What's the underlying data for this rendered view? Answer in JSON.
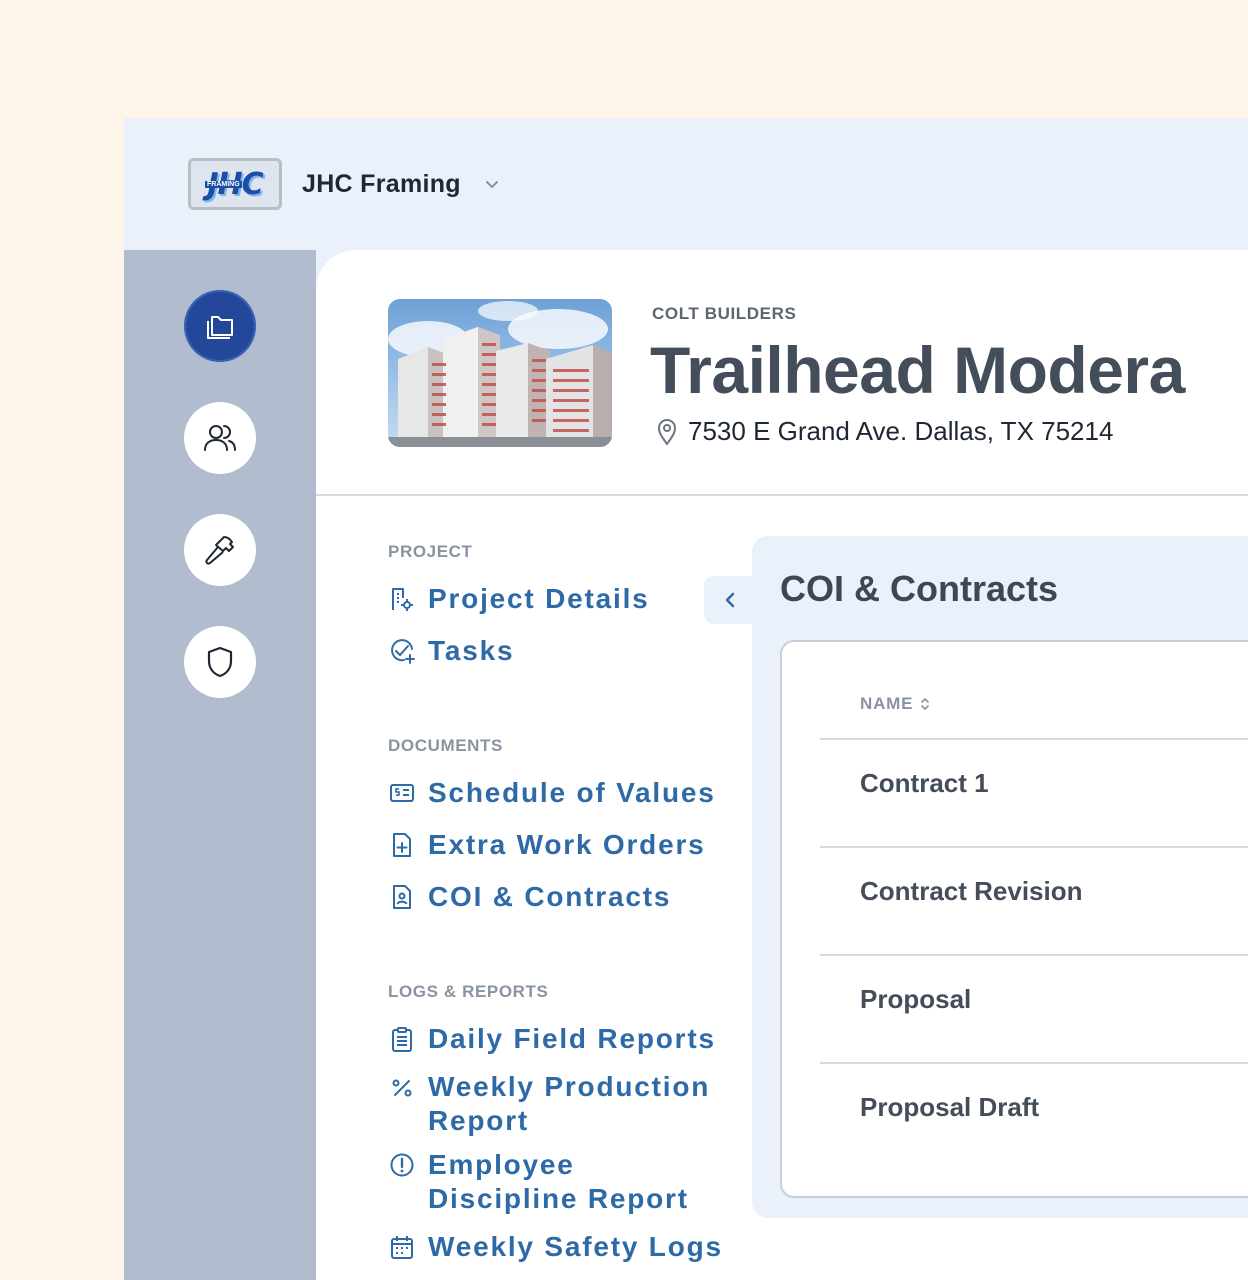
{
  "header": {
    "logo_text": "JHC",
    "logo_sub": "FRAMING",
    "company": "JHC Framing"
  },
  "rail": {
    "items": [
      {
        "icon": "folders-icon",
        "active": true
      },
      {
        "icon": "users-icon",
        "active": false
      },
      {
        "icon": "hammer-icon",
        "active": false
      },
      {
        "icon": "shield-icon",
        "active": false
      }
    ]
  },
  "project": {
    "client": "COLT BUILDERS",
    "title": "Trailhead Modera",
    "address": "7530 E Grand Ave. Dallas, TX 75214"
  },
  "nav": {
    "project_label": "PROJECT",
    "project_items": [
      {
        "label": "Project Details",
        "icon": "building-gear-icon"
      },
      {
        "label": "Tasks",
        "icon": "circle-check-plus-icon"
      }
    ],
    "documents_label": "DOCUMENTS",
    "document_items": [
      {
        "label": "Schedule of Values",
        "icon": "dollar-list-icon"
      },
      {
        "label": "Extra Work Orders",
        "icon": "file-plus-icon"
      },
      {
        "label": "COI & Contracts",
        "icon": "file-user-icon"
      }
    ],
    "logs_label": "LOGS & REPORTS",
    "log_items": [
      {
        "label": "Daily Field Reports",
        "icon": "clipboard-icon"
      },
      {
        "label": "Weekly Production Report",
        "icon": "percent-icon"
      },
      {
        "label": "Employee Discipline Report",
        "icon": "alert-circle-icon"
      },
      {
        "label": "Weekly Safety Logs",
        "icon": "calendar-icon"
      }
    ]
  },
  "content": {
    "title": "COI & Contracts",
    "column_name": "NAME",
    "rows": [
      "Contract 1",
      "Contract Revision",
      "Proposal",
      "Proposal Draft"
    ]
  }
}
